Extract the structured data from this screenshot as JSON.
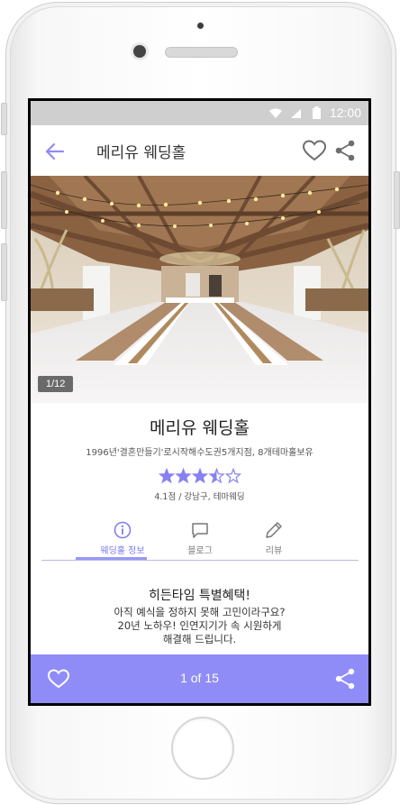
{
  "status_bar": {
    "time": "12:00",
    "icons": [
      "wifi-icon",
      "cellular-signal-icon",
      "battery-icon"
    ]
  },
  "app_bar": {
    "title": "메리유 웨딩홀",
    "icons": [
      "back-arrow-icon",
      "heart-outline-icon",
      "share-icon"
    ]
  },
  "gallery": {
    "counter": "1/12"
  },
  "venue": {
    "name": "메리유 웨딩홀",
    "description": "1996년'결혼만들기'로시작해수도권5개지점, 8개테마홀보유",
    "star_rating": 3.5,
    "star_max": 5,
    "rating_line": "4.1점 / 강남구, 테마웨딩"
  },
  "tabs": [
    {
      "label": "웨딩홀 정보",
      "icon": "info-circle-icon",
      "active": true
    },
    {
      "label": "블로그",
      "icon": "chat-bubble-icon",
      "active": false
    },
    {
      "label": "리뷰",
      "icon": "pencil-icon",
      "active": false
    }
  ],
  "promo": {
    "title": "히든타임 특별혜택!",
    "lines": [
      "아직 예식을 정하지 못해 고민이라구요?",
      "20년 노하우! 인연지기가 속 시원하게",
      "해결해 드립니다."
    ]
  },
  "bottom_bar": {
    "page_indicator": "1 of 15",
    "icons": [
      "heart-outline-icon",
      "share-icon"
    ]
  },
  "colors": {
    "accent": "#8f8cf7",
    "accent_text": "#7f7cf2",
    "star": "#8582f0",
    "status_bar": "#cfcfcf"
  }
}
